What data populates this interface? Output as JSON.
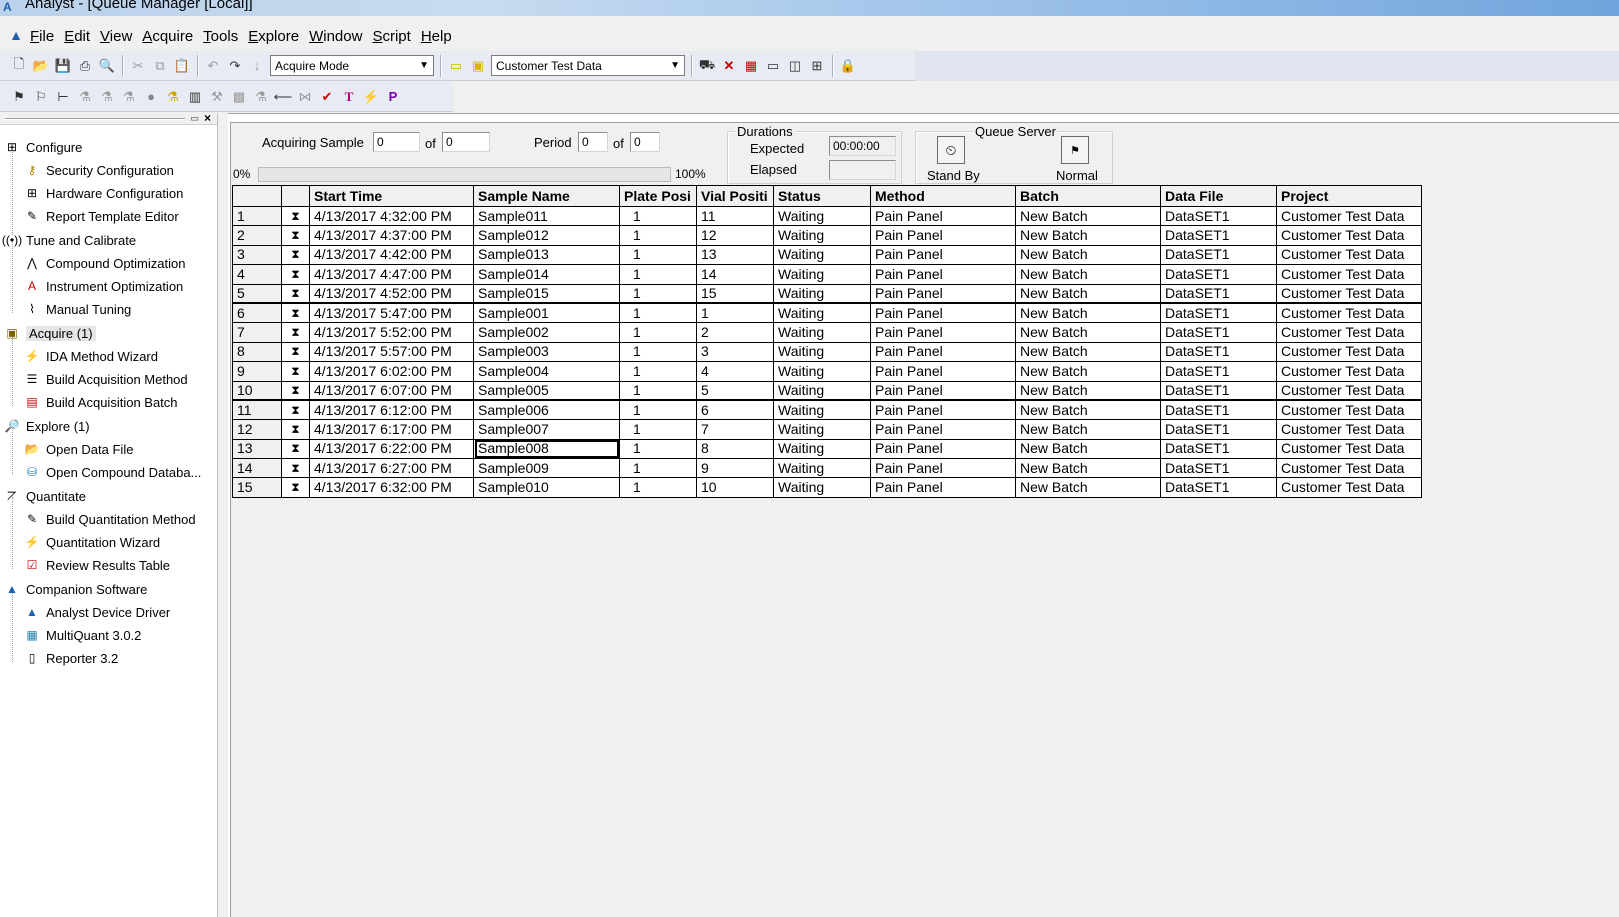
{
  "window": {
    "title": "Analyst - [Queue Manager [Local]]"
  },
  "menu": [
    "File",
    "Edit",
    "View",
    "Acquire",
    "Tools",
    "Explore",
    "Window",
    "Script",
    "Help"
  ],
  "toolbar": {
    "mode_combo": "Acquire Mode",
    "project_combo": "Customer Test Data"
  },
  "nav": {
    "categories": [
      {
        "label": "Configure",
        "icon": "configure-icon",
        "items": [
          "Security Configuration",
          "Hardware Configuration",
          "Report Template Editor"
        ]
      },
      {
        "label": "Tune and Calibrate",
        "icon": "tune-icon",
        "items": [
          "Compound Optimization",
          "Instrument Optimization",
          "Manual Tuning"
        ]
      },
      {
        "label": "Acquire  (1)",
        "icon": "acquire-icon",
        "items": [
          "IDA Method Wizard",
          "Build Acquisition Method",
          "Build Acquisition Batch"
        ]
      },
      {
        "label": "Explore  (1)",
        "icon": "explore-icon",
        "items": [
          "Open Data File",
          "Open Compound Databa..."
        ]
      },
      {
        "label": "Quantitate",
        "icon": "quantitate-icon",
        "items": [
          "Build Quantitation Method",
          "Quantitation Wizard",
          "Review Results Table"
        ]
      },
      {
        "label": "Companion Software",
        "icon": "companion-icon",
        "items": [
          "Analyst Device Driver",
          "MultiQuant 3.0.2",
          "Reporter 3.2"
        ]
      }
    ]
  },
  "status": {
    "acquiring_label": "Acquiring Sample",
    "acquiring_value": "0",
    "of_label": "of",
    "acquiring_total": "0",
    "period_label": "Period",
    "period_value": "0",
    "period_total": "0",
    "progress_start": "0%",
    "progress_end": "100%",
    "progress_fraction": 0,
    "durations_label": "Durations",
    "expected_label": "Expected",
    "expected_value": "00:00:00",
    "elapsed_label": "Elapsed",
    "elapsed_value": "",
    "queue_server_label": "Queue Server",
    "standby_label": "Stand By",
    "normal_label": "Normal"
  },
  "table": {
    "headers": [
      "",
      "",
      "Start Time",
      "Sample Name",
      "Plate Posi",
      "Vial Positi",
      "Status",
      "Method",
      "Batch",
      "Data File",
      "Project"
    ],
    "rows": [
      [
        "1",
        "4/13/2017 4:32:00 PM",
        "Sample011",
        "1",
        "11",
        "Waiting",
        "Pain Panel",
        "New Batch",
        "DataSET1",
        "Customer Test Data"
      ],
      [
        "2",
        "4/13/2017 4:37:00 PM",
        "Sample012",
        "1",
        "12",
        "Waiting",
        "Pain Panel",
        "New Batch",
        "DataSET1",
        "Customer Test Data"
      ],
      [
        "3",
        "4/13/2017 4:42:00 PM",
        "Sample013",
        "1",
        "13",
        "Waiting",
        "Pain Panel",
        "New Batch",
        "DataSET1",
        "Customer Test Data"
      ],
      [
        "4",
        "4/13/2017 4:47:00 PM",
        "Sample014",
        "1",
        "14",
        "Waiting",
        "Pain Panel",
        "New Batch",
        "DataSET1",
        "Customer Test Data"
      ],
      [
        "5",
        "4/13/2017 4:52:00 PM",
        "Sample015",
        "1",
        "15",
        "Waiting",
        "Pain Panel",
        "New Batch",
        "DataSET1",
        "Customer Test Data"
      ],
      [
        "6",
        "4/13/2017 5:47:00 PM",
        "Sample001",
        "1",
        "1",
        "Waiting",
        "Pain Panel",
        "New Batch",
        "DataSET1",
        "Customer Test Data"
      ],
      [
        "7",
        "4/13/2017 5:52:00 PM",
        "Sample002",
        "1",
        "2",
        "Waiting",
        "Pain Panel",
        "New Batch",
        "DataSET1",
        "Customer Test Data"
      ],
      [
        "8",
        "4/13/2017 5:57:00 PM",
        "Sample003",
        "1",
        "3",
        "Waiting",
        "Pain Panel",
        "New Batch",
        "DataSET1",
        "Customer Test Data"
      ],
      [
        "9",
        "4/13/2017 6:02:00 PM",
        "Sample004",
        "1",
        "4",
        "Waiting",
        "Pain Panel",
        "New Batch",
        "DataSET1",
        "Customer Test Data"
      ],
      [
        "10",
        "4/13/2017 6:07:00 PM",
        "Sample005",
        "1",
        "5",
        "Waiting",
        "Pain Panel",
        "New Batch",
        "DataSET1",
        "Customer Test Data"
      ],
      [
        "11",
        "4/13/2017 6:12:00 PM",
        "Sample006",
        "1",
        "6",
        "Waiting",
        "Pain Panel",
        "New Batch",
        "DataSET1",
        "Customer Test Data"
      ],
      [
        "12",
        "4/13/2017 6:17:00 PM",
        "Sample007",
        "1",
        "7",
        "Waiting",
        "Pain Panel",
        "New Batch",
        "DataSET1",
        "Customer Test Data"
      ],
      [
        "13",
        "4/13/2017 6:22:00 PM",
        "Sample008",
        "1",
        "8",
        "Waiting",
        "Pain Panel",
        "New Batch",
        "DataSET1",
        "Customer Test Data"
      ],
      [
        "14",
        "4/13/2017 6:27:00 PM",
        "Sample009",
        "1",
        "9",
        "Waiting",
        "Pain Panel",
        "New Batch",
        "DataSET1",
        "Customer Test Data"
      ],
      [
        "15",
        "4/13/2017 6:32:00 PM",
        "Sample010",
        "1",
        "10",
        "Waiting",
        "Pain Panel",
        "New Batch",
        "DataSET1",
        "Customer Test Data"
      ]
    ],
    "status_icon": "hourglass-icon"
  }
}
